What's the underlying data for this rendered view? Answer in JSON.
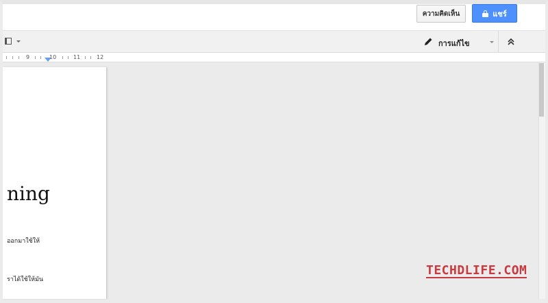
{
  "header": {
    "comments_label": "ความคิดเห็น",
    "share_label": "แชร์"
  },
  "toolbar": {
    "mode_label": "การแก้ไข"
  },
  "ruler": {
    "marks": [
      "9",
      "10",
      "11",
      "12"
    ]
  },
  "document": {
    "heading_fragment": "ning",
    "line1_fragment": "ออกมาใช้ให้",
    "line2_fragment": "ราได้ใช้ให้มัน"
  },
  "watermark": {
    "text": "TECHDLIFE.COM"
  },
  "colors": {
    "share_button": "#4d90fe",
    "watermark": "#c9393d",
    "canvas": "#ebebeb"
  }
}
